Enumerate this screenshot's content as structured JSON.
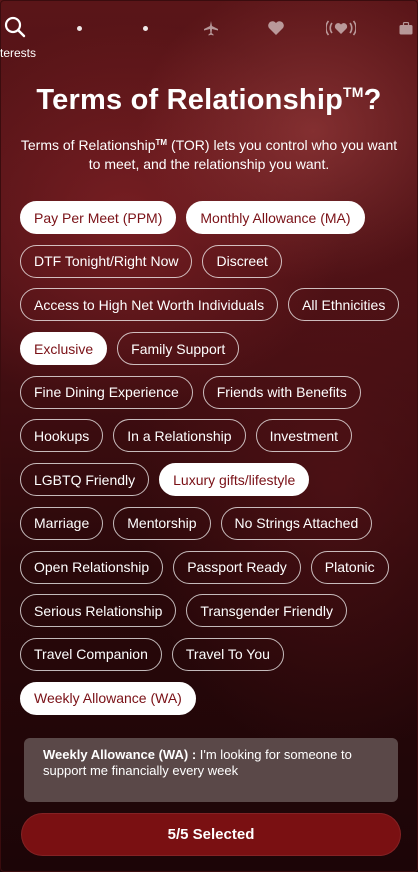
{
  "nav": {
    "search_label": "terests"
  },
  "header": {
    "title": "Terms of Relationship",
    "title_tm": "TM",
    "title_q": "?",
    "subtitle_a": "Terms of Relationship",
    "subtitle_tm": "TM",
    "subtitle_b": " (TOR) lets you control who you want to meet, and the relationship you want."
  },
  "options": [
    [
      {
        "label": "Pay Per Meet (PPM)",
        "selected": true
      },
      {
        "label": "Monthly Allowance (MA)",
        "selected": true
      }
    ],
    [
      {
        "label": "DTF Tonight/Right Now",
        "selected": false
      },
      {
        "label": "Discreet",
        "selected": false
      }
    ],
    [
      {
        "label": "Access to High Net Worth Individuals",
        "selected": false
      },
      {
        "label": "All Ethnicities",
        "selected": false
      }
    ],
    [
      {
        "label": "Exclusive",
        "selected": true
      },
      {
        "label": "Family Support",
        "selected": false
      }
    ],
    [
      {
        "label": "Fine Dining Experience",
        "selected": false
      },
      {
        "label": "Friends with Benefits",
        "selected": false
      }
    ],
    [
      {
        "label": "Hookups",
        "selected": false
      },
      {
        "label": "In a Relationship",
        "selected": false
      },
      {
        "label": "Investment",
        "selected": false
      }
    ],
    [
      {
        "label": "LGBTQ Friendly",
        "selected": false
      },
      {
        "label": "Luxury gifts/lifestyle",
        "selected": true
      }
    ],
    [
      {
        "label": "Marriage",
        "selected": false
      },
      {
        "label": "Mentorship",
        "selected": false
      },
      {
        "label": "No Strings Attached",
        "selected": false
      }
    ],
    [
      {
        "label": "Open Relationship",
        "selected": false
      },
      {
        "label": "Passport Ready",
        "selected": false
      },
      {
        "label": "Platonic",
        "selected": false
      }
    ],
    [
      {
        "label": "Serious Relationship",
        "selected": false
      },
      {
        "label": "Transgender Friendly",
        "selected": false
      }
    ],
    [
      {
        "label": "Travel Companion",
        "selected": false
      },
      {
        "label": "Travel To You",
        "selected": false
      }
    ],
    [
      {
        "label": "Weekly Allowance (WA)",
        "selected": true
      }
    ]
  ],
  "description": {
    "term": "Weekly Allowance (WA) :",
    "text": " I'm looking for someone to support me financially every week"
  },
  "cta": {
    "label": "5/5 Selected"
  },
  "colors": {
    "accent": "#7a1012",
    "selected_text": "#7a1016"
  }
}
